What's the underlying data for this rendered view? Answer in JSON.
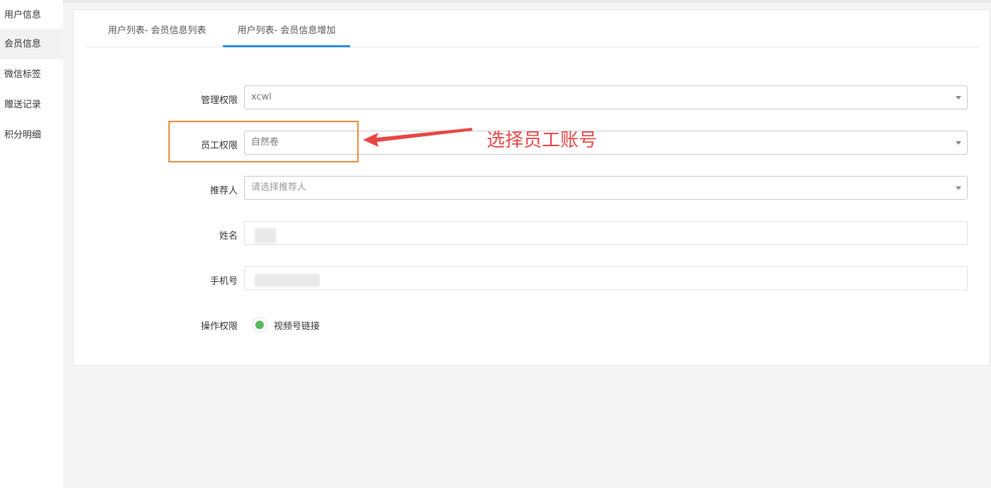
{
  "sidebar": {
    "items": [
      {
        "label": "用户信息"
      },
      {
        "label": "会员信息"
      },
      {
        "label": "微信标签"
      },
      {
        "label": "赠送记录"
      },
      {
        "label": "积分明细"
      }
    ]
  },
  "tabs": [
    {
      "label": "用户列表- 会员信息列表"
    },
    {
      "label": "用户列表- 会员信息增加"
    }
  ],
  "form": {
    "admin_permission": {
      "label": "管理权限",
      "value": "xcwl"
    },
    "staff_permission": {
      "label": "员工权限",
      "value": "自然卷"
    },
    "referrer": {
      "label": "推荐人",
      "placeholder": "请选择推荐人"
    },
    "name": {
      "label": "姓名"
    },
    "phone": {
      "label": "手机号"
    },
    "operation_permission": {
      "label": "操作权限",
      "option": "视频号链接"
    }
  },
  "annotation": {
    "text": "选择员工账号",
    "color": "#e84646",
    "box_color": "#ed8a3a"
  },
  "colors": {
    "accent": "#2d8cf0",
    "radio_checked": "#5cb85c"
  },
  "icons": {
    "dropdown": "caret-down-icon",
    "arrow": "red-arrow-left-icon"
  }
}
